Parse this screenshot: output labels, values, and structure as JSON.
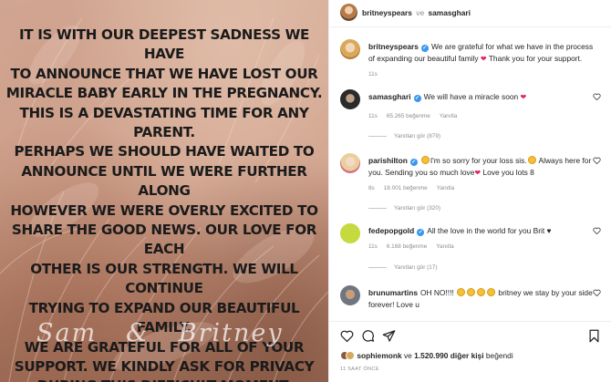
{
  "post": {
    "statement": "IT IS WITH OUR DEEPEST SADNESS WE HAVE\nTO ANNOUNCE THAT WE HAVE LOST OUR\nMIRACLE BABY EARLY IN THE PREGNANCY.\nTHIS IS A DEVASTATING TIME FOR ANY PARENT.\nPERHAPS WE SHOULD HAVE WAITED TO\nANNOUNCE UNTIL WE WERE FURTHER ALONG\nHOWEVER WE WERE OVERLY EXCITED TO\nSHARE THE GOOD NEWS. OUR LOVE FOR EACH\nOTHER IS OUR STRENGTH. WE WILL CONTINUE\nTRYING TO EXPAND OUR BEAUTIFUL FAMILY.\nWE ARE GRATEFUL FOR ALL OF YOUR\nSUPPORT.  WE KINDLY ASK FOR PRIVACY\nDURING THIS DIFFICULT MOMENT.",
    "signature": "Sam   &   Britney"
  },
  "header": {
    "user1": "britneyspears",
    "separator": "ve",
    "user2": "samasghari"
  },
  "caption": {
    "user": "britneyspears",
    "text_a": "We are grateful for what we have in the process of expanding our beautiful family",
    "text_b": "Thank you for your support.",
    "time": "11s"
  },
  "comments": [
    {
      "user": "samasghari",
      "text_a": "We will have a miracle soon",
      "text_b": "",
      "time": "11s",
      "likes": "65.265 beğenme",
      "reply": "Yanıtla",
      "view_replies": "Yanıtları gör (879)"
    },
    {
      "user": "parishilton",
      "text_a": "I'm so sorry for your loss sis.",
      "text_b": "Always here for you. Sending you so much love",
      "text_c": "Love you lots 8",
      "time": "8s",
      "likes": "18.001 beğenme",
      "reply": "Yanıtla",
      "view_replies": "Yanıtları gör (320)"
    },
    {
      "user": "fedepopgold",
      "text_a": "All the love in the world for you Brit",
      "time": "11s",
      "likes": "6.168 beğenme",
      "reply": "Yanıtla",
      "view_replies": "Yanıtları gör (17)"
    },
    {
      "user": "brunumartins",
      "text_a": "OH NO!!!!",
      "text_b": "britney we stay by your side forever! Love u"
    }
  ],
  "likes": {
    "user": "sophiemonk",
    "connector": "ve",
    "count": "1.520.990",
    "rest": "diğer kişi",
    "verb": "beğendi"
  },
  "timestamp": "11 SAAT ÖNCE",
  "icons": [
    "heart-icon",
    "comment-icon",
    "share-icon",
    "bookmark-icon",
    "verified-icon"
  ]
}
